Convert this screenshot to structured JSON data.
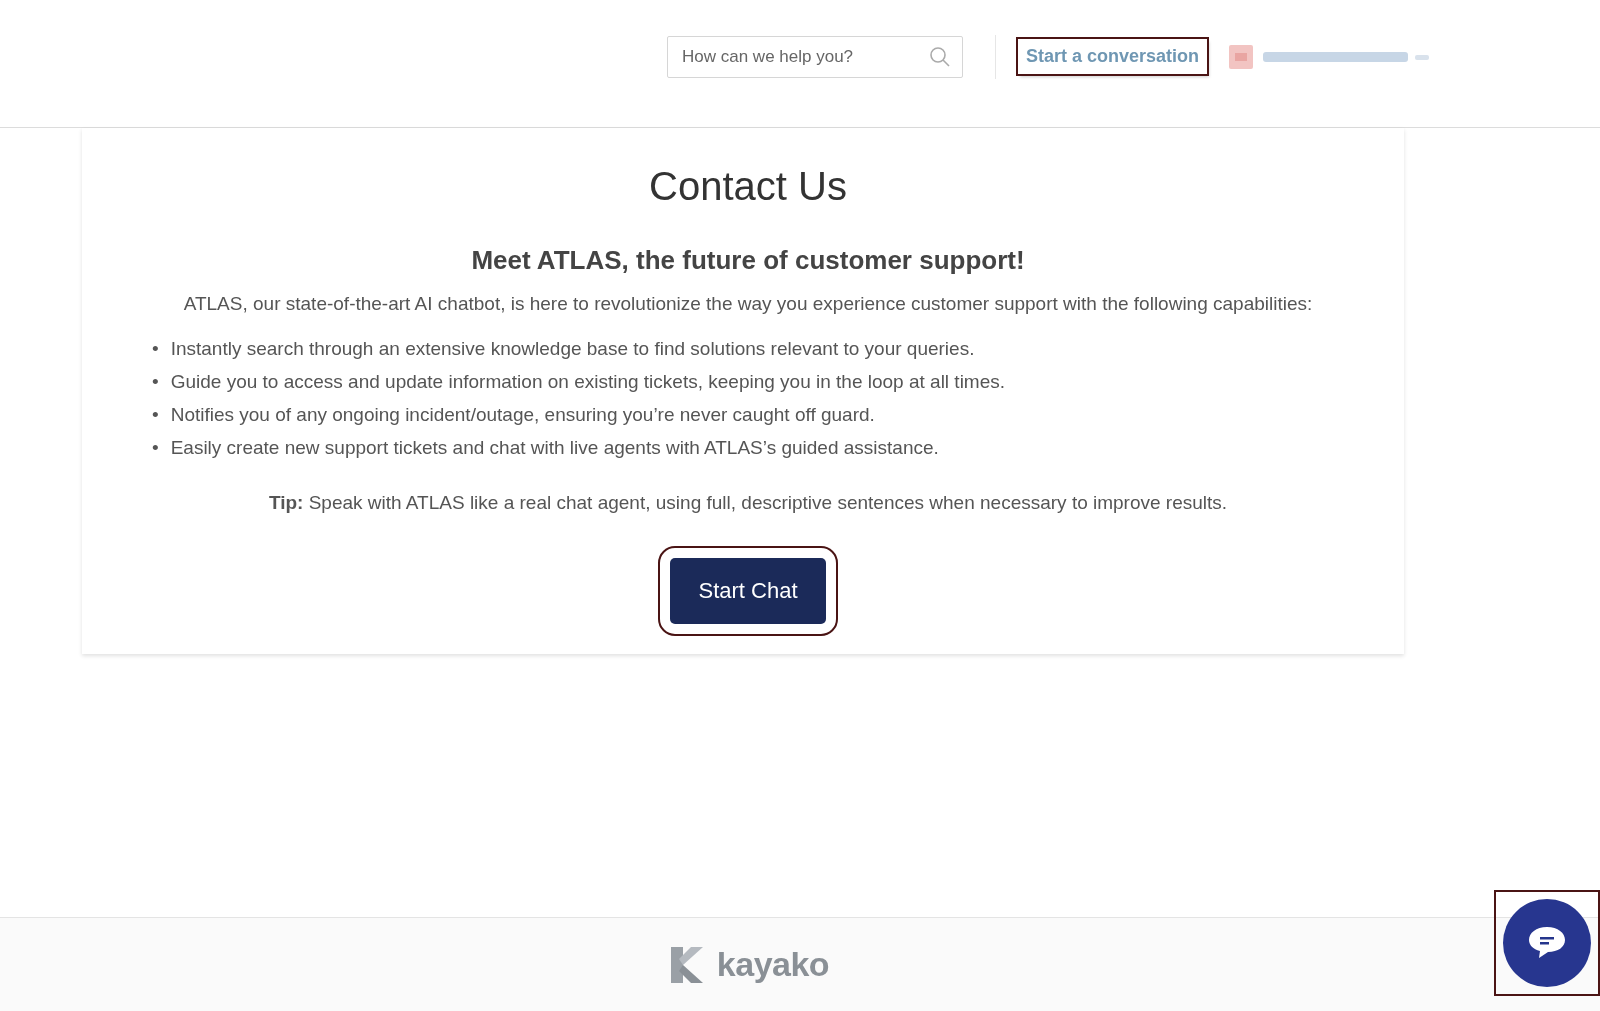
{
  "header": {
    "search": {
      "placeholder": "How can we help you?"
    },
    "conversation_link": "Start a conversation"
  },
  "card": {
    "title": "Contact Us",
    "subtitle": "Meet ATLAS, the future of customer support!",
    "intro": "ATLAS, our state-of-the-art AI chatbot, is here to revolutionize the way you experience customer support with the following capabilities:",
    "bullet": "•",
    "capabilities": [
      "Instantly search through an extensive knowledge base to find solutions relevant to your queries.",
      "Guide you to access and update information on existing tickets, keeping you in the loop at all times.",
      "Notifies you of any ongoing incident/outage, ensuring you’re never caught off guard.",
      "Easily create new support tickets and chat with live agents with ATLAS’s guided assistance."
    ],
    "tip": "**Tip:** Speak with ATLAS like a real chat agent, using full, descriptive sentences when necessary to improve results.",
    "button": "Start Chat"
  },
  "footer": {
    "brand": "kayako"
  }
}
